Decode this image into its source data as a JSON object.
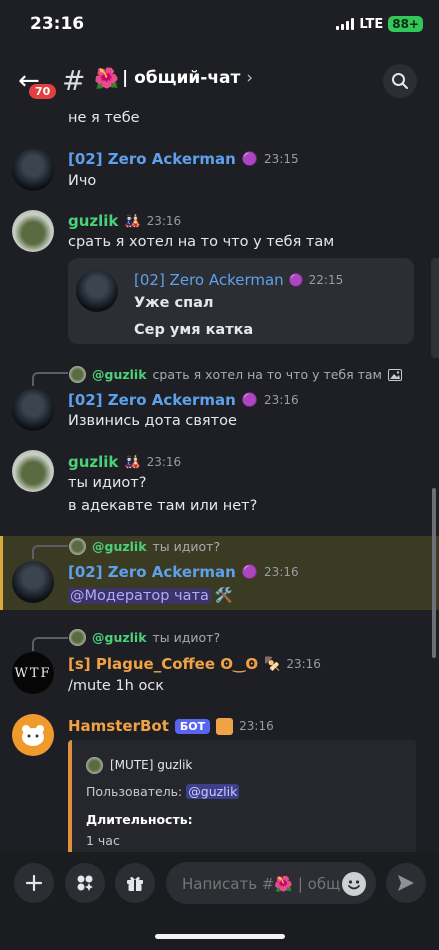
{
  "status": {
    "time": "23:16",
    "network": "LTE",
    "battery": "88+"
  },
  "header": {
    "back_badge": "70",
    "hash": "#",
    "channel_emoji": "🌺",
    "channel_name": "| общий-чат",
    "chevron": "›"
  },
  "messages": {
    "prev_text": "не я тебе",
    "m1": {
      "author": "[02] Zero Ackerman",
      "emoji": "🟣",
      "time": "23:15",
      "text": "Ичо"
    },
    "m2": {
      "author": "guzlik",
      "emoji": "🎎",
      "time": "23:16",
      "text": "срать я хотел на то что  у тебя там",
      "embed": {
        "author": "[02] Zero Ackerman",
        "emoji": "🟣",
        "time": "22:15",
        "line1": "Уже спал",
        "line2": "Сер умя катка"
      }
    },
    "m3": {
      "reply": {
        "author": "@guzlik",
        "text": "срать я хотел на то что  у тебя там",
        "icon": "image-icon"
      },
      "author": "[02] Zero Ackerman",
      "emoji": "🟣",
      "time": "23:16",
      "text": "Извинись дота святое"
    },
    "m4": {
      "author": "guzlik",
      "emoji": "🎎",
      "time": "23:16",
      "line1": "ты идиот?",
      "line2": "в адекавте там или нет?"
    },
    "m5": {
      "reply": {
        "author": "@guzlik",
        "text": "ты идиот?"
      },
      "author": "[02] Zero Ackerman",
      "emoji": "🟣",
      "time": "23:16",
      "mention": "@Модератор чата",
      "mention_emoji": "🛠️"
    },
    "m6": {
      "reply": {
        "author": "@guzlik",
        "text": "ты идиот?"
      },
      "avatar_text": "WTF",
      "author": "[s] Plague_Coffee ʘ‿ʘ",
      "emoji": "🍢",
      "time": "23:16",
      "text": "/mute 1h оск"
    },
    "m7": {
      "author": "HamsterBot",
      "bot_label": "БОТ",
      "time": "23:16",
      "embed": {
        "title": "[MUTE] guzlik",
        "user_label": "Пользователь:",
        "user_mention": "@guzlik",
        "duration_label": "Длительность:",
        "duration_value": "1 час"
      }
    }
  },
  "composer": {
    "placeholder": "Написать #🌺 | общ..."
  },
  "colors": {
    "background": "#1e1f24",
    "accent_blue": "#5ea1ea",
    "accent_green": "#4bd17a",
    "highlight": "#3b3a22",
    "bot_badge": "#5865f2"
  }
}
